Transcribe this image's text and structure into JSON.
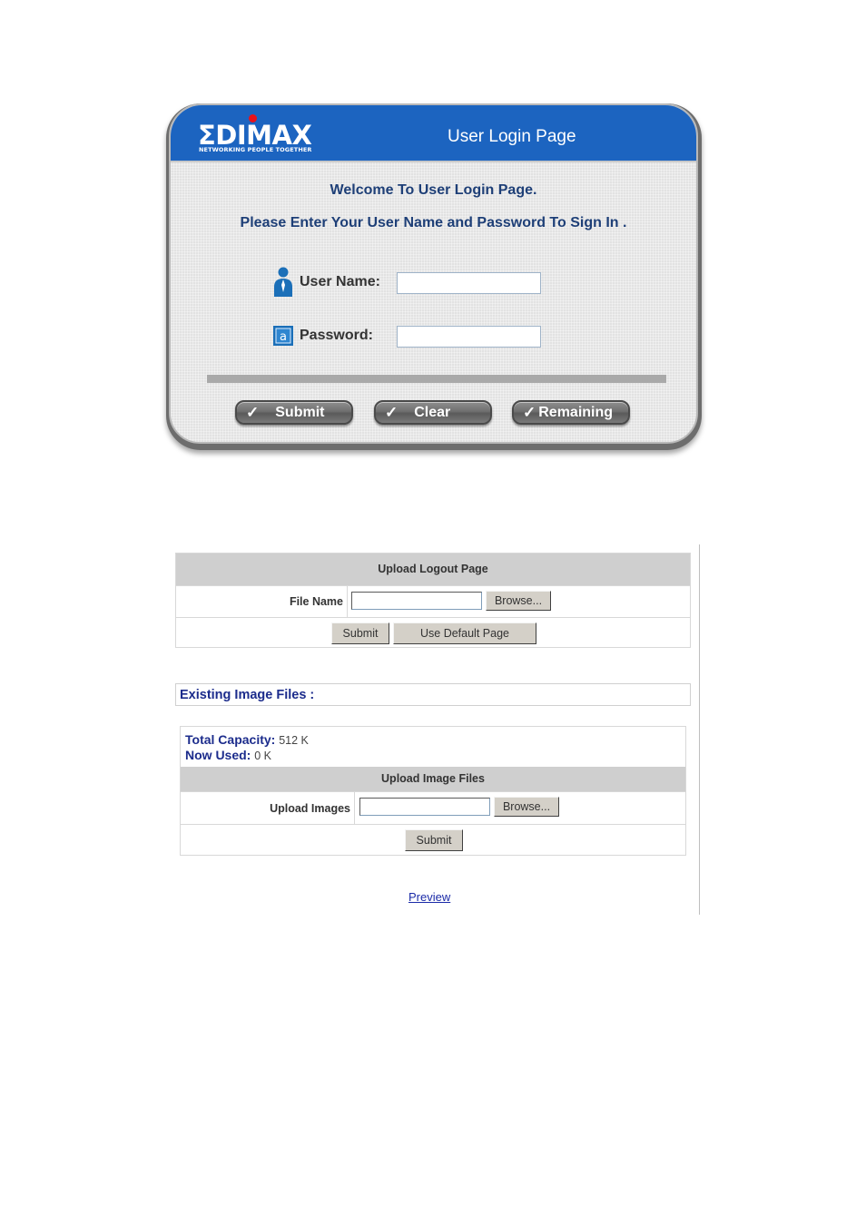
{
  "login": {
    "brand": {
      "logo_text": "ΣDIMAX",
      "tagline": "NETWORKING PEOPLE TOGETHER",
      "header_color": "#1c64c0",
      "dot_color": "#e8121a"
    },
    "header_title": "User Login Page",
    "welcome_line1": "Welcome To User Login Page.",
    "welcome_line2": "Please Enter Your User Name and Password To Sign In .",
    "username": {
      "label": "User Name:",
      "value": "",
      "icon": "user-icon"
    },
    "password": {
      "label": "Password:",
      "value": "",
      "icon": "keyboard-key-icon"
    },
    "buttons": {
      "check_glyph": "✓",
      "submit": "Submit",
      "clear": "Clear",
      "remaining": "Remaining"
    }
  },
  "upload_logout": {
    "title": "Upload Logout Page",
    "file_name_label": "File Name",
    "file_name_value": "",
    "browse": "Browse...",
    "submit": "Submit",
    "use_default": "Use Default Page"
  },
  "existing_images": {
    "title": "Existing Image Files :",
    "total_capacity_label": "Total Capacity:",
    "total_capacity_value": "512 K",
    "now_used_label": "Now Used:",
    "now_used_value": "0 K"
  },
  "upload_images": {
    "title": "Upload Image Files",
    "label": "Upload Images",
    "value": "",
    "browse": "Browse...",
    "submit": "Submit"
  },
  "preview_link": "Preview"
}
